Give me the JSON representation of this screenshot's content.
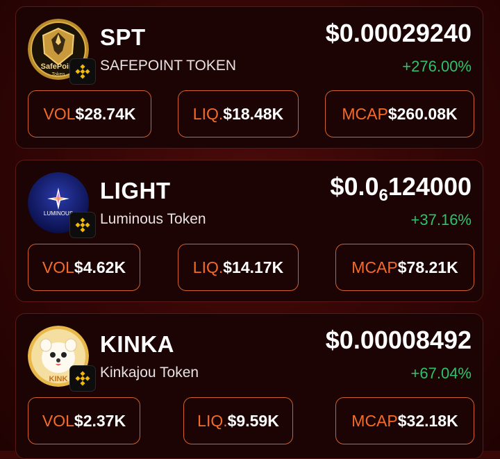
{
  "tokens": [
    {
      "symbol": "SPT",
      "name": "SAFEPOINT TOKEN",
      "price_main": "$0.00029240",
      "price_prefix": "",
      "price_sub": "",
      "price_suffix": "",
      "change": "+276.00%",
      "vol_label": "VOL",
      "vol_value": "$28.74K",
      "liq_label": "LIQ.",
      "liq_value": "$18.48K",
      "mcap_label": "MCAP",
      "mcap_value": "$260.08K",
      "logo_text_1": "SafePoint",
      "logo_text_2": "Token"
    },
    {
      "symbol": "LIGHT",
      "name": "Luminous Token",
      "price_main": "",
      "price_prefix": "$0.0",
      "price_sub": "6",
      "price_suffix": "124000",
      "change": "+37.16%",
      "vol_label": "VOL",
      "vol_value": "$4.62K",
      "liq_label": "LIQ.",
      "liq_value": "$14.17K",
      "mcap_label": "MCAP",
      "mcap_value": "$78.21K",
      "logo_text_1": "LUMINOUS"
    },
    {
      "symbol": "KINKA",
      "name": "Kinkajou Token",
      "price_main": "$0.00008492",
      "price_prefix": "",
      "price_sub": "",
      "price_suffix": "",
      "change": "+67.04%",
      "vol_label": "VOL",
      "vol_value": "$2.37K",
      "liq_label": "LIQ.",
      "liq_value": "$9.59K",
      "mcap_label": "MCAP",
      "mcap_value": "$32.18K",
      "logo_text_1": "KINK"
    }
  ],
  "icons": {
    "chain": "bnb-chain-icon"
  },
  "colors": {
    "accent": "#f36c2a",
    "positive": "#2ec36a",
    "card_bg": "#1c0304",
    "page_bg": "#3a0707"
  }
}
